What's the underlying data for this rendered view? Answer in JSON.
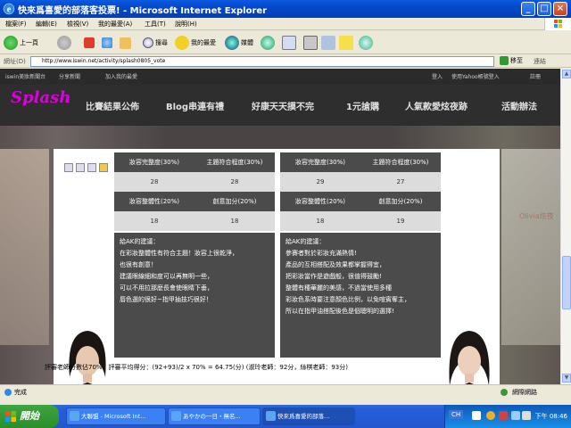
{
  "window": {
    "title": "快來爲喜愛的部落客投票! - Microsoft Internet Explorer"
  },
  "menu": [
    "檔案(F)",
    "編輯(E)",
    "檢視(V)",
    "我的最愛(A)",
    "工具(T)",
    "說明(H)"
  ],
  "toolbar": {
    "back": "上一頁",
    "search": "搜尋",
    "favorites": "我的最愛",
    "media": "媒體"
  },
  "address": {
    "label": "網址(D)",
    "url": "http://www.iswin.net/activity/splash0805_vote",
    "go": "移至",
    "links": "連結"
  },
  "site": {
    "top_links": [
      "iswin美妝新聞台",
      "分享新聞",
      "加入我的最愛"
    ],
    "top_right": [
      "登入",
      "使用Yahoo帳號登入",
      "註冊"
    ],
    "logo": "Splash",
    "nav": [
      "比賽結果公佈",
      "Blog串連有禮",
      "好康天天摸不完",
      "1元搶購",
      "人氣款愛炫夜跡",
      "活動辦法"
    ],
    "side_text": "Olivia炫夜"
  },
  "scores": {
    "left": {
      "headers1": [
        "妝容完整度(30%)",
        "主題符合程度(30%)"
      ],
      "values1": [
        "28",
        "28"
      ],
      "headers2": [
        "妝容整體性(20%)",
        "創意加分(20%)"
      ],
      "values2": [
        "18",
        "18"
      ],
      "advice": [
        "給AK的建議：",
        "在彩妝整體性有符合主題！妝容上很乾淨，",
        "也很有創意！",
        "建議眼線細和度可以再無明一些，",
        "可以不用拉那麼長會使眼睛下垂，",
        "唇色選的很好~指甲抽技巧很好！"
      ]
    },
    "right": {
      "headers1": [
        "妝容完整度(30%)",
        "主題符合程度(30%)"
      ],
      "values1": [
        "29",
        "27"
      ],
      "headers2": [
        "妝容整體性(20%)",
        "創意加分(20%)"
      ],
      "values2": [
        "18",
        "19"
      ],
      "advice": [
        "給AK的建議：",
        "參賽者對於彩妝充滿熱情!",
        "產品的互相搭配及效果都掌握得宜，",
        "把彩妝當作是遊戲般，很值得鼓勵!",
        "整體有種華麗的美感，不過當使用多種",
        "彩妝色系時要注意顏色比例，以免喧賓奪主，",
        "所以在指甲油搭配後色是個聰明的選擇!"
      ]
    },
    "summary": "評審老師分數佔70%，評審平均得分：(92+93)/2 x 70% = 64.75(分) (淑玲老師：92分，絲棋老師：93分)"
  },
  "status": {
    "left": "完成",
    "zone": "網際網路"
  },
  "taskbar": {
    "start": "開始",
    "tasks": [
      "大聯盟 - Microsoft Int...",
      "あやかの一日・無名...",
      "快來爲喜愛的部落..."
    ],
    "lang": "CH",
    "clock": "下午 08:46"
  },
  "colors": {
    "title_blue": "#0548c8",
    "taskbar_blue": "#245edb",
    "panel_dark": "#4b4b4b"
  }
}
